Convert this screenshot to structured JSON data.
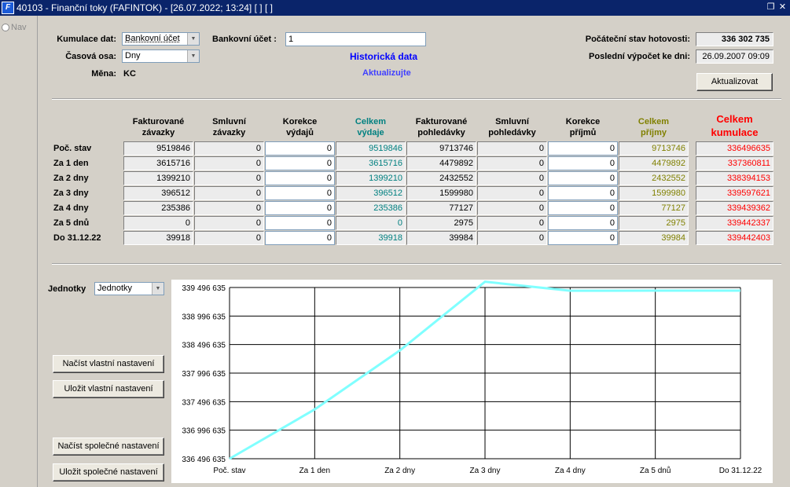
{
  "window": {
    "title": "40103 - Finanční toky (FAFINTOK) - [26.07.2022; 13:24]  [ ]  [ ]"
  },
  "nav": {
    "label": "Nav"
  },
  "form": {
    "kumulace_label": "Kumulace dat:",
    "kumulace_value": "Bankovní účet",
    "osa_label": "Časová osa:",
    "osa_value": "Dny",
    "mena_label": "Měna:",
    "mena_value": "KC",
    "ucet_label": "Bankovní účet :",
    "ucet_value": "1",
    "historicka": "Historická data",
    "aktualizujte": "Aktualizujte",
    "stav_label": "Počáteční stav hotovosti:",
    "stav_value": "336 302 735",
    "vypocet_label": "Poslední výpočet ke dni:",
    "vypocet_value": "26.09.2007  09:09",
    "aktualizovat_btn": "Aktualizovat"
  },
  "table": {
    "columns": [
      "Fakturované\nzávazky",
      "Smluvní\nzávazky",
      "Korekce\nvýdajů",
      "Celkem\nvýdaje",
      "Fakturované\npohledávky",
      "Smluvní\npohledávky",
      "Korekce\npříjmů",
      "Celkem\npříjmy",
      "Celkem\nkumulace"
    ],
    "rows": [
      {
        "label": "Poč. stav",
        "v": [
          "9519846",
          "0",
          "0",
          "9519846",
          "9713746",
          "0",
          "0",
          "9713746",
          "336496635"
        ]
      },
      {
        "label": "Za 1 den",
        "v": [
          "3615716",
          "0",
          "0",
          "3615716",
          "4479892",
          "0",
          "0",
          "4479892",
          "337360811"
        ]
      },
      {
        "label": "Za 2 dny",
        "v": [
          "1399210",
          "0",
          "0",
          "1399210",
          "2432552",
          "0",
          "0",
          "2432552",
          "338394153"
        ]
      },
      {
        "label": "Za 3 dny",
        "v": [
          "396512",
          "0",
          "0",
          "396512",
          "1599980",
          "0",
          "0",
          "1599980",
          "339597621"
        ]
      },
      {
        "label": "Za 4 dny",
        "v": [
          "235386",
          "0",
          "0",
          "235386",
          "77127",
          "0",
          "0",
          "77127",
          "339439362"
        ]
      },
      {
        "label": "Za 5 dnů",
        "v": [
          "0",
          "0",
          "0",
          "0",
          "2975",
          "0",
          "0",
          "2975",
          "339442337"
        ]
      },
      {
        "label": "Do 31.12.22",
        "v": [
          "39918",
          "0",
          "0",
          "39918",
          "39984",
          "0",
          "0",
          "39984",
          "339442403"
        ]
      }
    ]
  },
  "units": {
    "label": "Jednotky",
    "value": "Jednotky"
  },
  "buttons": {
    "load_own": "Načíst vlastní nastavení",
    "save_own": "Uložit vlastní nastavení",
    "load_shared": "Načíst společné nastavení",
    "save_shared": "Uložit společné nastavení"
  },
  "colors": {
    "vydaje": "#008080",
    "prijmy": "#808000",
    "kumulace": "#ff0000",
    "line": "#80ffff",
    "accent": "#0000ff"
  },
  "chart_data": {
    "type": "line",
    "categories": [
      "Poč. stav",
      "Za 1 den",
      "Za 2 dny",
      "Za 3 dny",
      "Za 4 dny",
      "Za 5 dnů",
      "Do 31.12.22"
    ],
    "series": [
      {
        "values": [
          336496635,
          337360811,
          338394153,
          339597621,
          339439362,
          339442337,
          339442403
        ]
      }
    ],
    "ylim": [
      336496635,
      339496635
    ],
    "yticks": [
      "339 496 635",
      "338 996 635",
      "338 496 635",
      "337 996 635",
      "337 496 635",
      "336 996 635",
      "336 496 635"
    ],
    "grid": true
  }
}
